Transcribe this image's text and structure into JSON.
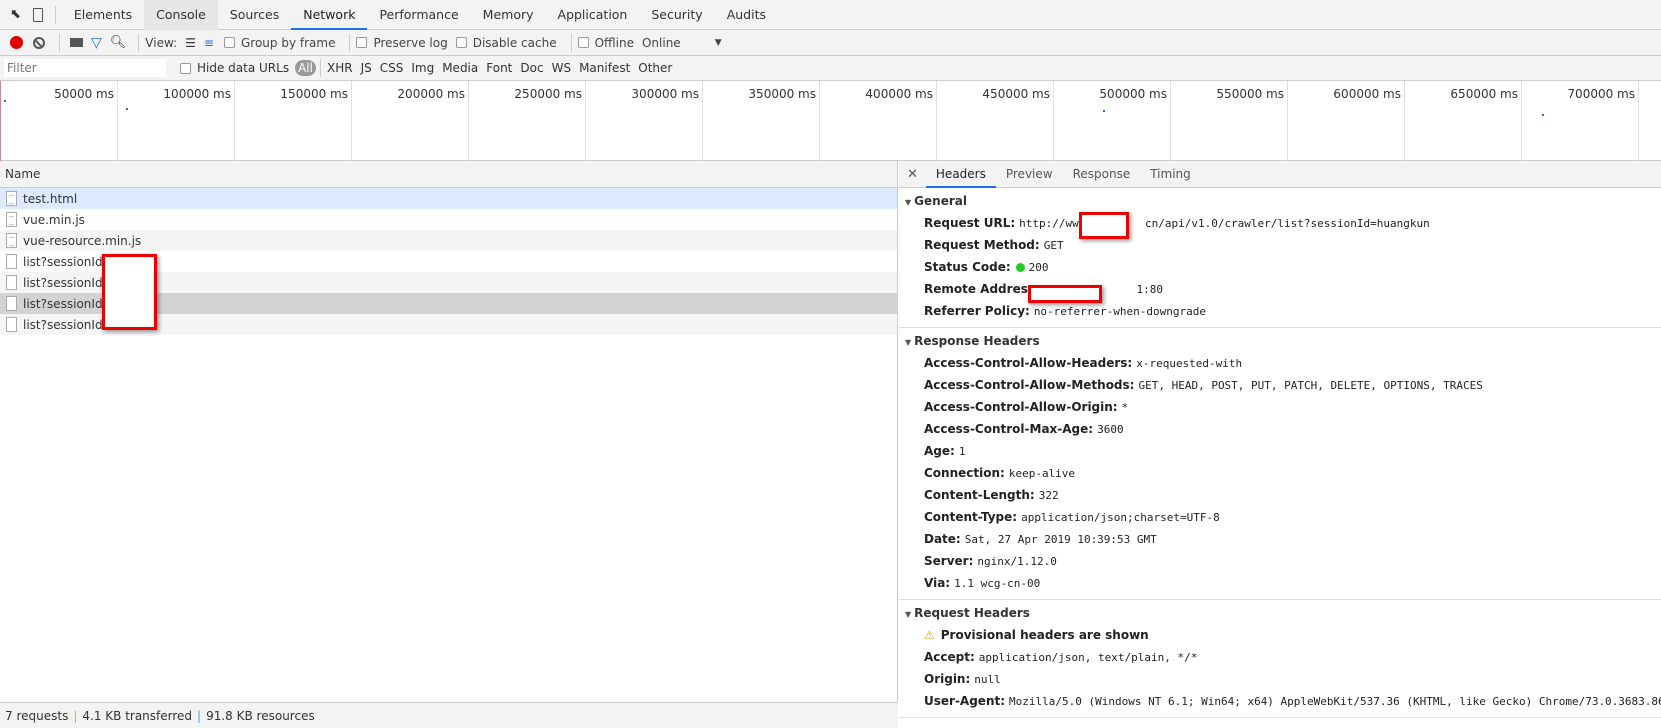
{
  "tabs": [
    "Elements",
    "Console",
    "Sources",
    "Network",
    "Performance",
    "Memory",
    "Application",
    "Security",
    "Audits"
  ],
  "active_tab": "Network",
  "toolbar": {
    "view_label": "View:",
    "group_by_frame": "Group by frame",
    "preserve_log": "Preserve log",
    "disable_cache": "Disable cache",
    "offline": "Offline",
    "throttle": "Online",
    "record_color": "#e00000"
  },
  "filter": {
    "placeholder": "Filter",
    "hide_data_urls": "Hide data URLs",
    "types": [
      "All",
      "XHR",
      "JS",
      "CSS",
      "Img",
      "Media",
      "Font",
      "Doc",
      "WS",
      "Manifest",
      "Other"
    ]
  },
  "timeline_ticks": [
    "50000 ms",
    "100000 ms",
    "150000 ms",
    "200000 ms",
    "250000 ms",
    "300000 ms",
    "350000 ms",
    "400000 ms",
    "450000 ms",
    "500000 ms",
    "550000 ms",
    "600000 ms",
    "650000 ms",
    "700000 ms"
  ],
  "requests": {
    "header": "Name",
    "rows": [
      "test.html",
      "vue.min.js",
      "vue-resource.min.js",
      "list?sessionId=h",
      "list?sessionId=h",
      "list?sessionId=h",
      "list?sessionId=h"
    ]
  },
  "status": {
    "requests": "7 requests",
    "transferred": "4.1 KB transferred",
    "resources": "91.8 KB resources"
  },
  "detail": {
    "tabs": [
      "Headers",
      "Preview",
      "Response",
      "Timing"
    ],
    "general": {
      "title": "General",
      "items": [
        {
          "k": "Request URL:",
          "v": "http://www.        cn/api/v1.0/crawler/list?sessionId=huangkun"
        },
        {
          "k": "Request Method:",
          "v": "GET"
        },
        {
          "k": "Status Code:",
          "v": "200"
        },
        {
          "k": "Remote Address:",
          "v": "              1:80"
        },
        {
          "k": "Referrer Policy:",
          "v": "no-referrer-when-downgrade"
        }
      ]
    },
    "response": {
      "title": "Response Headers",
      "items": [
        {
          "k": "Access-Control-Allow-Headers:",
          "v": "x-requested-with"
        },
        {
          "k": "Access-Control-Allow-Methods:",
          "v": "GET, HEAD, POST, PUT, PATCH, DELETE, OPTIONS, TRACES"
        },
        {
          "k": "Access-Control-Allow-Origin:",
          "v": "*"
        },
        {
          "k": "Access-Control-Max-Age:",
          "v": "3600"
        },
        {
          "k": "Age:",
          "v": "1"
        },
        {
          "k": "Connection:",
          "v": "keep-alive"
        },
        {
          "k": "Content-Length:",
          "v": "322"
        },
        {
          "k": "Content-Type:",
          "v": "application/json;charset=UTF-8"
        },
        {
          "k": "Date:",
          "v": "Sat, 27 Apr 2019 10:39:53 GMT"
        },
        {
          "k": "Server:",
          "v": "nginx/1.12.0"
        },
        {
          "k": "Via:",
          "v": "1.1 wcg-cn-00"
        }
      ]
    },
    "request": {
      "title": "Request Headers",
      "warning": "Provisional headers are shown",
      "items": [
        {
          "k": "Accept:",
          "v": "application/json, text/plain, */*"
        },
        {
          "k": "Origin:",
          "v": "null"
        },
        {
          "k": "User-Agent:",
          "v": "Mozilla/5.0 (Windows NT 6.1; Win64; x64) AppleWebKit/537.36 (KHTML, like Gecko) Chrome/73.0.3683.86"
        }
      ]
    }
  }
}
